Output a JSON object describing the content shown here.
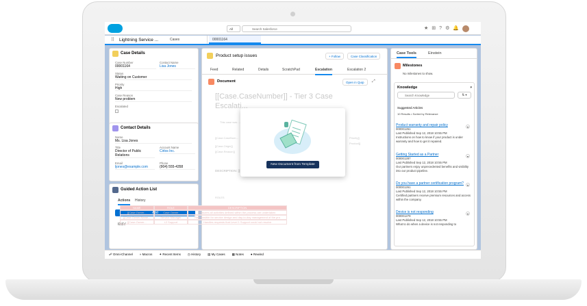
{
  "header": {
    "scope": "All",
    "search_placeholder": "Search Salesforce"
  },
  "nav": {
    "app_name": "Lightning Service ...",
    "tabs": [
      "Cases",
      "00001164"
    ]
  },
  "case_details": {
    "title": "Case Details",
    "fields": [
      {
        "label": "Case Number",
        "value": "00001164"
      },
      {
        "label": "Contact Name",
        "value": "Lisa Jones"
      },
      {
        "label": "Status",
        "value": "Waiting on Customer"
      },
      {
        "label": "Priority",
        "value": "High"
      },
      {
        "label": "Case Reason",
        "value": "New problem"
      },
      {
        "label": "Escalated",
        "value": ""
      }
    ]
  },
  "contact_details": {
    "title": "Contact Details",
    "fields": [
      {
        "label": "Name",
        "value": "Ms. Lisa Jones"
      },
      {
        "label": "Title",
        "value": "Director of Public Relations"
      },
      {
        "label": "Account Name",
        "value": "Cirlos Inc."
      },
      {
        "label": "Email",
        "value": "ljones@example.com"
      },
      {
        "label": "Phone",
        "value": "(904) 555-4358"
      }
    ]
  },
  "guided": {
    "title": "Guided Action List",
    "tabs": [
      "Actions",
      "History"
    ],
    "add": "Add",
    "item": "ID&V"
  },
  "main": {
    "title": "Product setup issues",
    "follow": "+ Follow",
    "classify": "Case Classification",
    "tabs": [
      "Feed",
      "Related",
      "Details",
      "ScratchPad",
      "Escalation",
      "Escalation 2"
    ],
    "doc_title": "Document",
    "open_quip": "Open in Quip",
    "doc_heading": "[[Case.CaseNumber]] - Tier 3 Case Escalati...",
    "faded_lines": [
      "This case was ...",
      "[[Case.CaseNum...",
      "[[Case.Origin]]",
      "[[Case.Reason]]",
      "Priority]]",
      "Product]]",
      "DESCRIPTION: [[C...",
      "ROLES"
    ],
    "table_head": [
      "NAME",
      "ROLE",
      "DESCRIPTION"
    ],
    "table_rows": [
      [
        "[[Case.Owner...",
        "Case Owner",
        "Ensures all activities defined within the process are undertaken"
      ],
      [
        "[[Case.Owner.Name...",
        "Service Manager",
        "Responsible for service design and day-to-day management of the pro"
      ],
      [
        "[[Case.Owner...",
        "L2 Support",
        "Handles requests that Level 1 Support could not resolve"
      ]
    ],
    "modal_button": "New Document from Template"
  },
  "right": {
    "tabs": [
      "Case Tools",
      "Einstein"
    ],
    "milestones": "Milestones",
    "no_milestones": "No milestones to show.",
    "knowledge": "Knowledge",
    "k_search": "Search Knowledge",
    "suggested": "Suggested Articles",
    "sorted": "10 Results • Sorted by Relevance",
    "articles": [
      {
        "title": "Product warranty and repair policy",
        "num": "000001251",
        "pub": "Last Published  Sep 12, 2018 10:55 PM",
        "desc": "Instructions on how to know if your product is under warranty and how to get it repaired."
      },
      {
        "title": "Getting Started as a Partner",
        "num": "000001287",
        "pub": "Last Published  Sep 12, 2018 10:55 PM",
        "desc": "Our partners enjoy unprecedented benefits and visibility into our product pipeline."
      },
      {
        "title": "Do you have a partner certification program?",
        "num": "000001261",
        "pub": "Last Published  Sep 12, 2018 10:55 PM",
        "desc": "Certified partners receive premium resources and access within the company."
      },
      {
        "title": "Device is not responding",
        "num": "000001279",
        "pub": "Last Published  Sep 12, 2018 10:55 PM",
        "desc": "What to do when a device is not responding to"
      }
    ]
  },
  "footer": [
    "Omni-Channel",
    "Macros",
    "Recent Items",
    "History",
    "My Cases",
    "Notes",
    "Rewind"
  ]
}
